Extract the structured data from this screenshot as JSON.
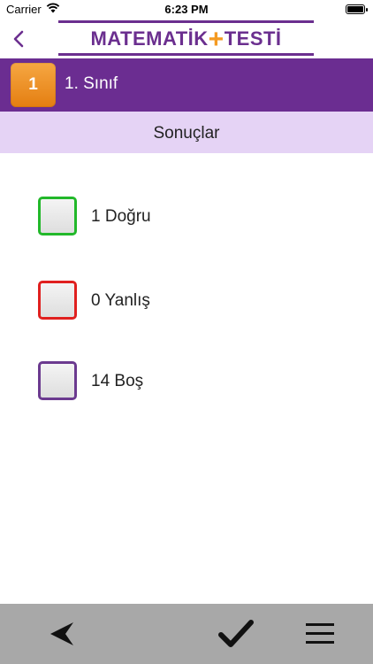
{
  "status_bar": {
    "carrier": "Carrier",
    "time": "6:23 PM"
  },
  "nav": {
    "logo_left": "MATEMATİK",
    "logo_right": "TESTİ"
  },
  "grade": {
    "number": "1",
    "label": "1. Sınıf"
  },
  "results": {
    "title": "Sonuçlar",
    "items": [
      {
        "label": "1 Doğru",
        "color": "#22b82a"
      },
      {
        "label": "0 Yanlış",
        "color": "#e0201f"
      },
      {
        "label": "14 Boş",
        "color": "#6b3a8f"
      }
    ]
  },
  "toolbar": {
    "background": "#a8a8a8",
    "icons": [
      "back-arrow-icon",
      "checkmark-icon",
      "menu-icon"
    ]
  }
}
